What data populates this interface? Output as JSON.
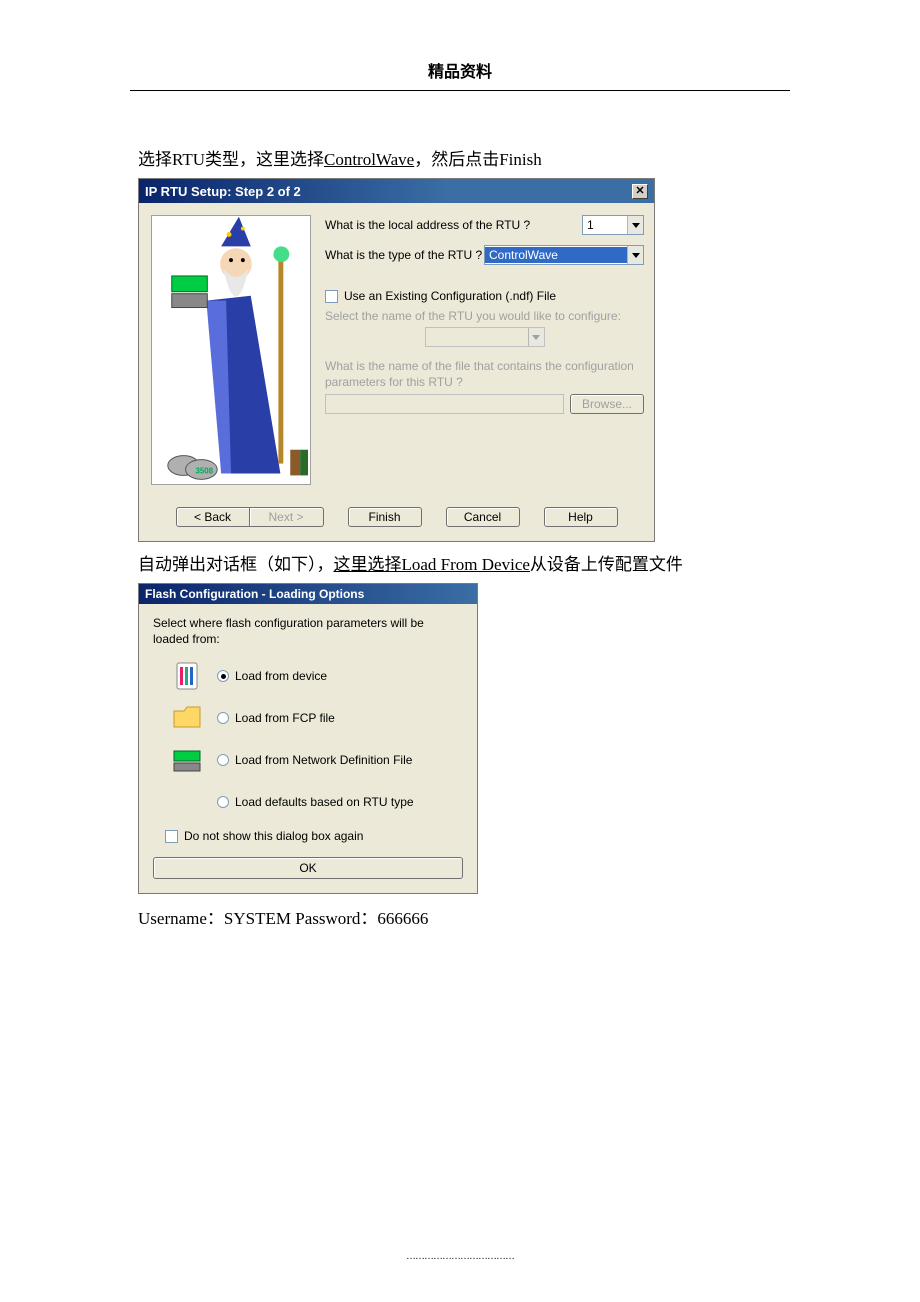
{
  "header": "精品资料",
  "instruction1": {
    "prefix": "选择RTU类型，这里选择",
    "hl": "ControlWave",
    "suffix": "，然后点击Finish"
  },
  "dialog1": {
    "title": "IP RTU Setup: Step 2 of 2",
    "q_local_addr": "What is the local address of the RTU ?",
    "local_addr_value": "1",
    "q_type": "What is the type of the RTU ?",
    "type_value": "ControlWave",
    "chk_existing": "Use an Existing Configuration (.ndf) File",
    "select_rtu_label": "Select the name of the RTU you would like to configure:",
    "file_label": "What is the name of the file that contains the configuration parameters for this RTU ?",
    "browse": "Browse...",
    "buttons": {
      "back": "< Back",
      "next": "Next >",
      "finish": "Finish",
      "cancel": "Cancel",
      "help": "Help"
    }
  },
  "instruction2": {
    "prefix": "自动弹出对话框（如下），",
    "hl": "这里选择Load From Device",
    "suffix": "从设备上传配置文件"
  },
  "dialog2": {
    "title": "Flash Configuration - Loading Options",
    "prompt": "Select where flash configuration parameters will be loaded from:",
    "opt1": "Load from device",
    "opt2": "Load from FCP file",
    "opt3": "Load from Network Definition File",
    "opt4": "Load defaults based on RTU type",
    "dontshow": "Do not show this dialog box again",
    "ok": "OK"
  },
  "credentials": "Username：SYSTEM Password：666666",
  "footer": "………………………………"
}
